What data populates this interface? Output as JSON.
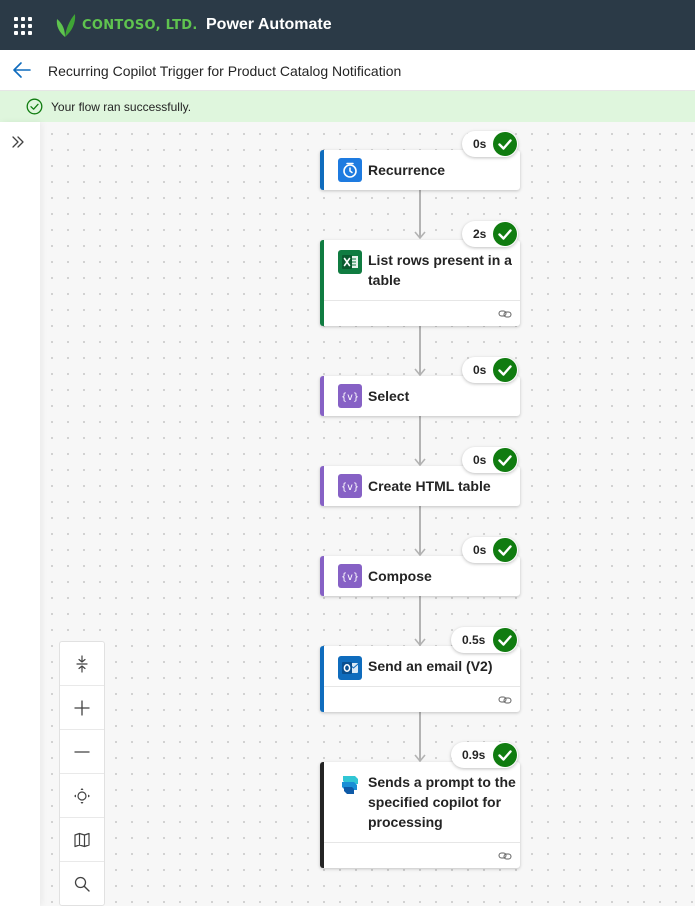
{
  "app": {
    "brand": "CONTOSO, LTD.",
    "product": "Power Automate"
  },
  "flow": {
    "title": "Recurring Copilot Trigger for Product Catalog Notification"
  },
  "banner": {
    "message": "Your flow ran successfully."
  },
  "steps": [
    {
      "label": "Recurrence",
      "duration": "0s",
      "icon": "clock-icon"
    },
    {
      "label": "List rows present in a table",
      "duration": "2s",
      "icon": "excel-icon"
    },
    {
      "label": "Select",
      "duration": "0s",
      "icon": "data-operation-icon"
    },
    {
      "label": "Create HTML table",
      "duration": "0s",
      "icon": "data-operation-icon"
    },
    {
      "label": "Compose",
      "duration": "0s",
      "icon": "data-operation-icon"
    },
    {
      "label": "Send an email (V2)",
      "duration": "0.5s",
      "icon": "outlook-icon"
    },
    {
      "label": "Sends a prompt to the specified copilot for processing",
      "duration": "0.9s",
      "icon": "copilot-studio-icon"
    }
  ],
  "zoom_controls": [
    "fit-vertical-icon",
    "zoom-in-icon",
    "zoom-out-icon",
    "fit-view-icon",
    "minimap-icon",
    "search-icon"
  ],
  "colors": {
    "header": "#2b3a47",
    "brand": "#5fc44f",
    "success": "#107c10",
    "success_banner": "#dff6dd",
    "trigger_accent": "#0f6cbd",
    "excel_accent": "#107c41",
    "data_operation_accent": "#8661c5",
    "copilot_accent": "#242424"
  }
}
